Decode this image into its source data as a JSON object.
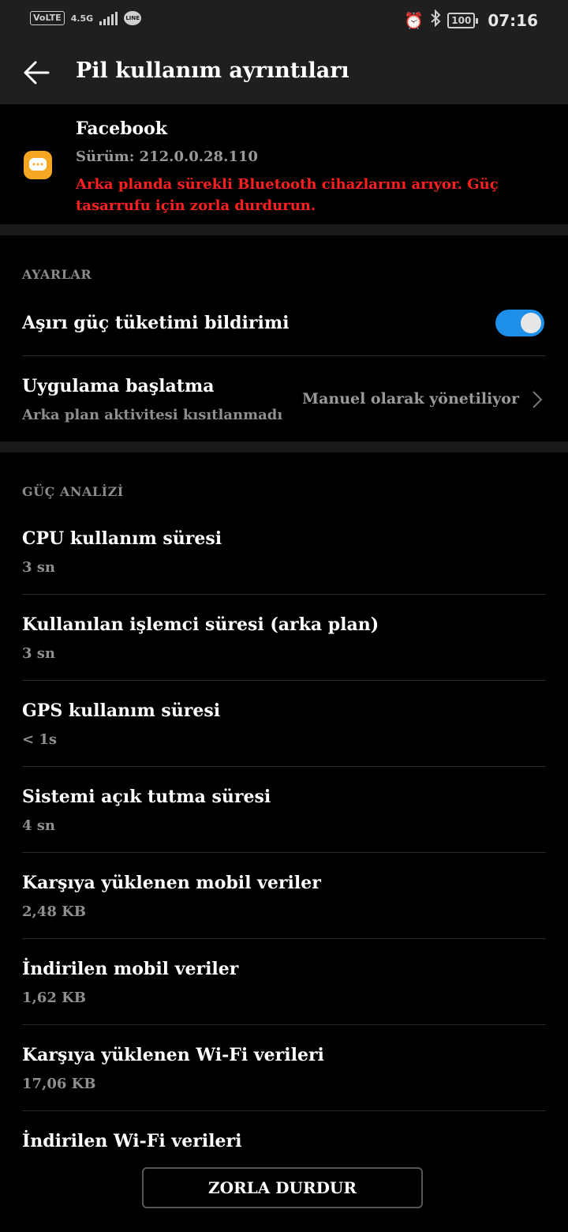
{
  "status_bar": {
    "volte": "VoLTE",
    "network": "4.5G",
    "line_label": "LINE",
    "battery": "100",
    "time": "07:16"
  },
  "header": {
    "title": "Pil kullanım ayrıntıları"
  },
  "app_info": {
    "name": "Facebook",
    "version": "Sürüm: 212.0.0.28.110",
    "warning": "Arka planda sürekli Bluetooth cihazlarını arıyor. Güç tasarrufu için zorla durdurun."
  },
  "settings": {
    "section_label": "AYARLAR",
    "excess_power_notification": {
      "label": "Aşırı güç tüketimi bildirimi",
      "enabled": true
    },
    "app_launch": {
      "label": "Uygulama başlatma",
      "sublabel": "Arka plan aktivitesi kısıtlanmadı",
      "value": "Manuel olarak yönetiliyor"
    }
  },
  "power_analysis": {
    "section_label": "GÜÇ ANALİZİ",
    "items": [
      {
        "label": "CPU kullanım süresi",
        "value": "3 sn"
      },
      {
        "label": "Kullanılan işlemci süresi (arka plan)",
        "value": "3 sn"
      },
      {
        "label": "GPS kullanım süresi",
        "value": "< 1s"
      },
      {
        "label": "Sistemi açık tutma süresi",
        "value": "4 sn"
      },
      {
        "label": "Karşıya yüklenen mobil veriler",
        "value": "2,48 KB"
      },
      {
        "label": "İndirilen mobil veriler",
        "value": "1,62 KB"
      },
      {
        "label": "Karşıya yüklenen Wi-Fi verileri",
        "value": "17,06 KB"
      },
      {
        "label": "İndirilen Wi-Fi verileri"
      }
    ]
  },
  "actions": {
    "force_stop": "ZORLA DURDUR"
  },
  "colors": {
    "warning": "#ff1f1f",
    "toggle_on": "#1e8fe8",
    "app_icon": "#f5a623"
  }
}
